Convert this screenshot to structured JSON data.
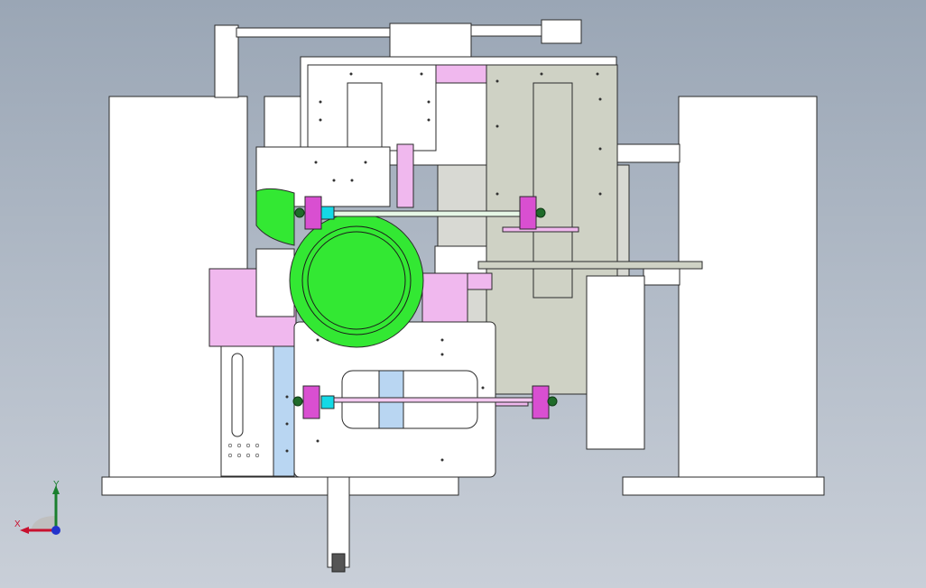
{
  "viewport": {
    "background_top": "#9aa6b5",
    "background_bottom": "#c9cfd8",
    "part_fill": "#ffffff",
    "part_edge": "#2a2a2a",
    "accent_pink": "#f0b8ee",
    "accent_magenta": "#d94fd1",
    "accent_green": "#33e833",
    "accent_grey": "#cfd2c5",
    "accent_blue": "#b9d6f2",
    "accent_cyan": "#14d9e6",
    "accent_darkgreen": "#1f6b2a"
  },
  "triad": {
    "x_label": "X",
    "y_label": "Y",
    "x_color": "#c8102e",
    "y_color": "#1a7f2e",
    "z_color": "#2233cc",
    "icon": "coordinate-triad-icon"
  }
}
